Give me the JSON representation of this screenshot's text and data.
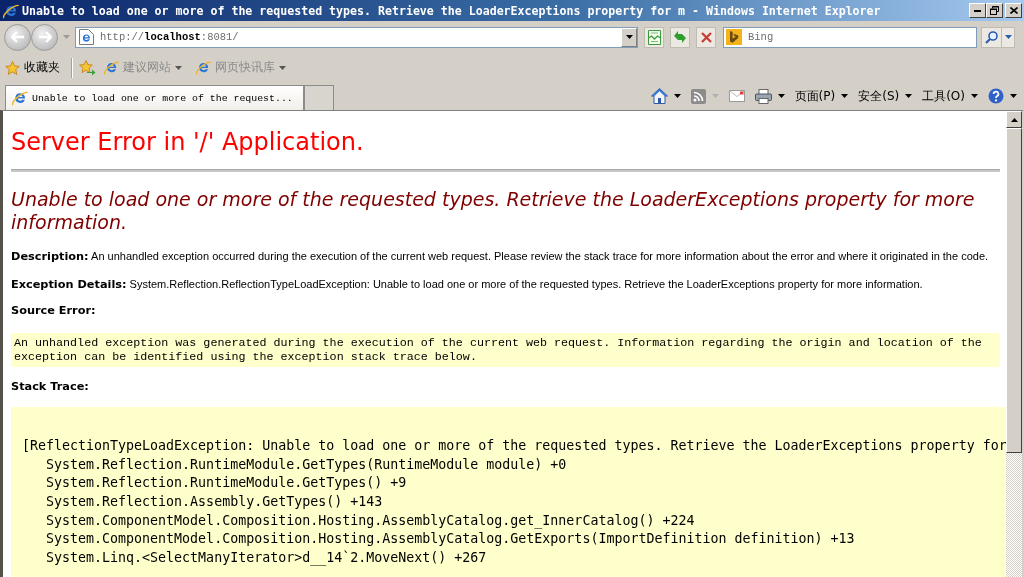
{
  "window": {
    "title": "Unable to load one or more of the requested types. Retrieve the LoaderExceptions property for m - Windows Internet Explorer"
  },
  "address_bar": {
    "url": "http://**localhost**:8081/"
  },
  "search": {
    "placeholder": "Bing"
  },
  "favorites_bar": {
    "label": "收藏夹",
    "links": [
      {
        "label": "建议网站",
        "disabled": true
      },
      {
        "label": "网页快讯库",
        "disabled": true
      }
    ]
  },
  "tabs": [
    {
      "label": "Unable to load one or more of the request...",
      "selected": true
    }
  ],
  "command_bar": {
    "menus": [
      {
        "label": "页面(P)"
      },
      {
        "label": "安全(S)"
      },
      {
        "label": "工具(O)"
      }
    ]
  },
  "page": {
    "title": "Server Error in '/' Application.",
    "message": "Unable to load one or more of the requested types. Retrieve the LoaderExceptions property for more information.",
    "sections": [
      {
        "kind": "paragraph",
        "text": "**Description:** An unhandled exception occurred during the execution of the current web request. Please review the stack trace for more information about the error and where it originated in the code."
      },
      {
        "kind": "paragraph",
        "text": "**Exception Details:** System.Reflection.ReflectionTypeLoadException: Unable to load one or more of the requested types. Retrieve the LoaderExceptions property for more information."
      },
      {
        "kind": "heading",
        "text": "Source Error:"
      },
      {
        "kind": "code",
        "text": "An unhandled exception was generated during the execution of the current web request. Information regarding the origin and location of the exception can be identified using the exception stack trace below."
      },
      {
        "kind": "heading",
        "text": "Stack Trace:"
      },
      {
        "kind": "stack_trace",
        "exception": "[ReflectionTypeLoadException: Unable to load one or more of the requested types. Retrieve the LoaderExceptions property for",
        "frames": [
          "System.Reflection.RuntimeModule.GetTypes(RuntimeModule module) +0",
          "System.Reflection.RuntimeModule.GetTypes() +9",
          "System.Reflection.Assembly.GetTypes() +143",
          "System.ComponentModel.Composition.Hosting.AssemblyCatalog.get_InnerCatalog() +224",
          "System.ComponentModel.Composition.Hosting.AssemblyCatalog.GetExports(ImportDefinition definition) +13",
          "System.Linq.<SelectManyIterator>d__14`2.MoveNext() +267"
        ]
      }
    ]
  }
}
